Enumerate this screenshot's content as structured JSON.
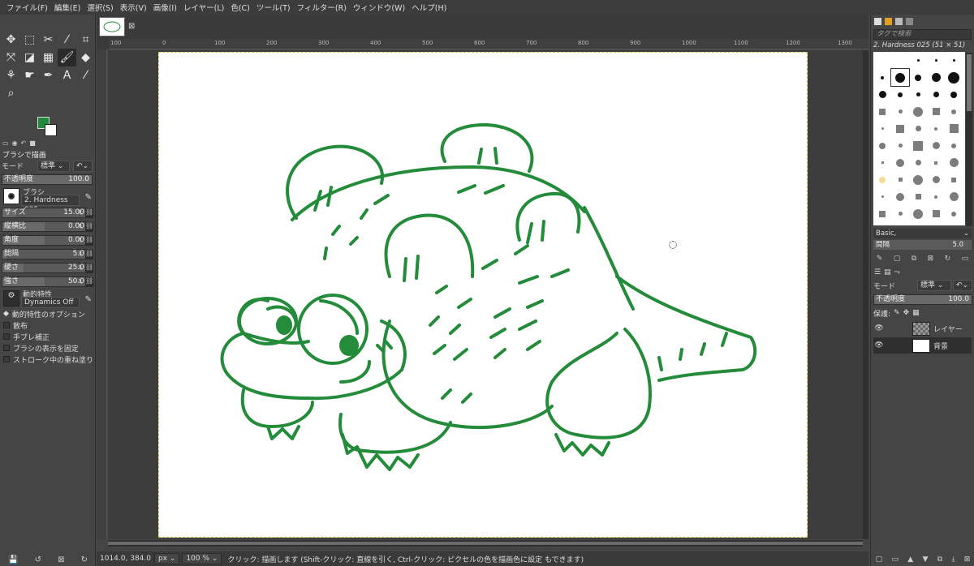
{
  "menu": [
    "ファイル(F)",
    "編集(E)",
    "選択(S)",
    "表示(V)",
    "画像(I)",
    "レイヤー(L)",
    "色(C)",
    "ツール(T)",
    "フィルター(R)",
    "ウィンドウ(W)",
    "ヘルプ(H)"
  ],
  "colors": {
    "foreground": "#1e8a3c",
    "background": "#ffffff",
    "stroke": "#238b3a"
  },
  "tools": [
    {
      "name": "move-tool",
      "glyph": "✥"
    },
    {
      "name": "rect-select-tool",
      "glyph": "⬚"
    },
    {
      "name": "scissors-tool",
      "glyph": "✂"
    },
    {
      "name": "fuzzy-select-tool",
      "glyph": "⁄"
    },
    {
      "name": "crop-tool",
      "glyph": "⌗"
    },
    {
      "name": "unified-transform-tool",
      "glyph": "⤧"
    },
    {
      "name": "bucket-fill-tool",
      "glyph": "◪"
    },
    {
      "name": "gradient-tool",
      "glyph": "▦"
    },
    {
      "name": "paintbrush-tool",
      "glyph": "🖌"
    },
    {
      "name": "eraser-tool",
      "glyph": "◆"
    },
    {
      "name": "clone-tool",
      "glyph": "⚘"
    },
    {
      "name": "smudge-tool",
      "glyph": "☛"
    },
    {
      "name": "paths-tool",
      "glyph": "✒"
    },
    {
      "name": "text-tool",
      "glyph": "A"
    },
    {
      "name": "color-picker-tool",
      "glyph": "⁄"
    },
    {
      "name": "zoom-tool",
      "glyph": "⌕"
    }
  ],
  "tool_options": {
    "title": "ブラシで描画",
    "mode_label": "モード",
    "mode_value": "標準",
    "opacity": {
      "label": "不透明度",
      "value": "100.0",
      "fraction": 1.0
    },
    "brush_label": "ブラシ",
    "brush_value": "2. Hardness 025",
    "size": {
      "label": "サイズ",
      "value": "15.00",
      "fraction": 0.15
    },
    "aspect": {
      "label": "縦横比",
      "value": "0.00",
      "fraction": 0.5
    },
    "angle": {
      "label": "角度",
      "value": "0.00",
      "fraction": 0.5
    },
    "spacing": {
      "label": "間隔",
      "value": "5.0",
      "fraction": 0.05
    },
    "hardness": {
      "label": "硬さ",
      "value": "25.0",
      "fraction": 0.25
    },
    "force": {
      "label": "強さ",
      "value": "50.0",
      "fraction": 0.5
    },
    "dynamics_label": "動的特性",
    "dynamics_value": "Dynamics Off",
    "dynamics_options": "動的特性のオプション",
    "checks": [
      "散布",
      "手ブレ補正",
      "ブラシの表示を固定",
      "ストローク中の重ね塗り"
    ]
  },
  "ruler": [
    "100",
    "0",
    "100",
    "200",
    "300",
    "400",
    "500",
    "600",
    "700",
    "800",
    "900",
    "1000",
    "1100",
    "1200",
    "1300"
  ],
  "status": {
    "coords": "1014.0, 384.0",
    "unit": "px",
    "zoom": "100 %",
    "message": "クリック: 描画します (Shift-クリック: 直線を引く, Ctrl-クリック: ピクセルの色を描画色に設定 もできます)"
  },
  "brushes_panel": {
    "tag_placeholder": "タグで検索",
    "selected_brush": "2. Hardness 025 (51 × 51)",
    "preset": "Basic,",
    "spacing_label": "間隔",
    "spacing_value": "5.0"
  },
  "layers_panel": {
    "mode_label": "モード",
    "mode_value": "標準",
    "opacity_label": "不透明度",
    "opacity_value": "100.0",
    "lock_label": "保護:",
    "layers": [
      {
        "name": "レイヤー",
        "thumb": "checker"
      },
      {
        "name": "背景",
        "thumb": "white"
      }
    ]
  }
}
